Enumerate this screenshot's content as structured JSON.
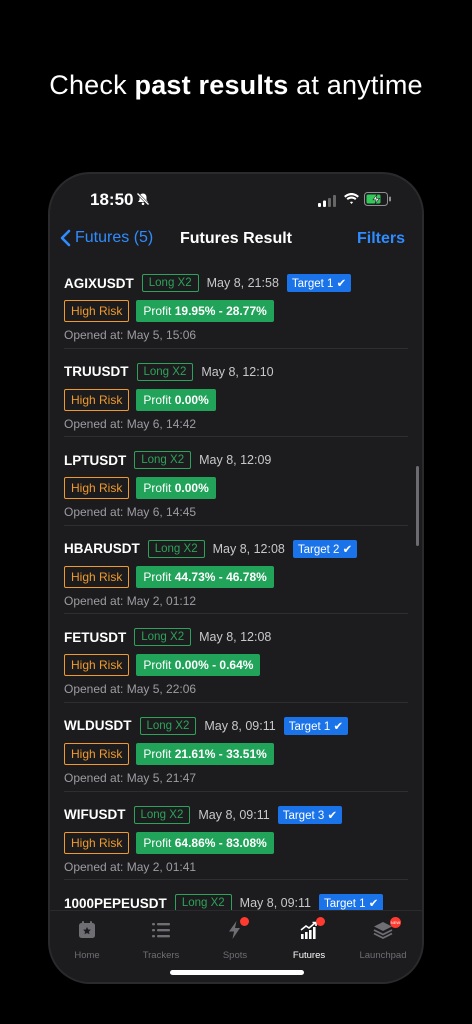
{
  "headline": {
    "pre": "Check ",
    "bold": "past results",
    "post": " at anytime"
  },
  "status_bar": {
    "time": "18:50"
  },
  "nav": {
    "back_label": "Futures (5)",
    "title": "Futures Result",
    "filters_label": "Filters"
  },
  "results": [
    {
      "symbol": "AGIXUSDT",
      "position": "Long X2",
      "date": "May 8, 21:58",
      "target": "Target 1 ✔",
      "risk": "High Risk",
      "profit_label": "Profit",
      "profit_value": "19.95% - 28.77%",
      "opened": "Opened at: May 5, 15:06"
    },
    {
      "symbol": "TRUUSDT",
      "position": "Long X2",
      "date": "May 8, 12:10",
      "target": "",
      "risk": "High Risk",
      "profit_label": "Profit",
      "profit_value": "0.00%",
      "opened": "Opened at: May 6, 14:42"
    },
    {
      "symbol": "LPTUSDT",
      "position": "Long X2",
      "date": "May 8, 12:09",
      "target": "",
      "risk": "High Risk",
      "profit_label": "Profit",
      "profit_value": "0.00%",
      "opened": "Opened at: May 6, 14:45"
    },
    {
      "symbol": "HBARUSDT",
      "position": "Long X2",
      "date": "May 8, 12:08",
      "target": "Target 2 ✔",
      "risk": "High Risk",
      "profit_label": "Profit",
      "profit_value": "44.73% - 46.78%",
      "opened": "Opened at: May 2, 01:12"
    },
    {
      "symbol": "FETUSDT",
      "position": "Long X2",
      "date": "May 8, 12:08",
      "target": "",
      "risk": "High Risk",
      "profit_label": "Profit",
      "profit_value": "0.00% - 0.64%",
      "opened": "Opened at: May 5, 22:06"
    },
    {
      "symbol": "WLDUSDT",
      "position": "Long X2",
      "date": "May 8, 09:11",
      "target": "Target 1 ✔",
      "risk": "High Risk",
      "profit_label": "Profit",
      "profit_value": "21.61% - 33.51%",
      "opened": "Opened at: May 5, 21:47"
    },
    {
      "symbol": "WIFUSDT",
      "position": "Long X2",
      "date": "May 8, 09:11",
      "target": "Target 3 ✔",
      "risk": "High Risk",
      "profit_label": "Profit",
      "profit_value": "64.86% - 83.08%",
      "opened": "Opened at: May 2, 01:41"
    },
    {
      "symbol": "1000PEPEUSDT",
      "position": "Long X2",
      "date": "May 8, 09:11",
      "target": "Target 1 ✔",
      "risk": "",
      "profit_label": "",
      "profit_value": "",
      "opened": ""
    }
  ],
  "tabs": [
    {
      "label": "Home",
      "icon": "home-star-icon",
      "active": false,
      "badge": false
    },
    {
      "label": "Trackers",
      "icon": "list-icon",
      "active": false,
      "badge": false
    },
    {
      "label": "Spots",
      "icon": "bolt-icon",
      "active": false,
      "badge": true
    },
    {
      "label": "Futures",
      "icon": "growth-chart-icon",
      "active": true,
      "badge": true
    },
    {
      "label": "Launchpad",
      "icon": "stack-icon",
      "active": false,
      "badge": true,
      "badge_text": "NEW"
    }
  ],
  "colors": {
    "accent": "#2f8cff",
    "long": "#2ea25a",
    "risk": "#f09a2c",
    "profit_bg": "#22a35a",
    "target_bg": "#1a73e8"
  }
}
